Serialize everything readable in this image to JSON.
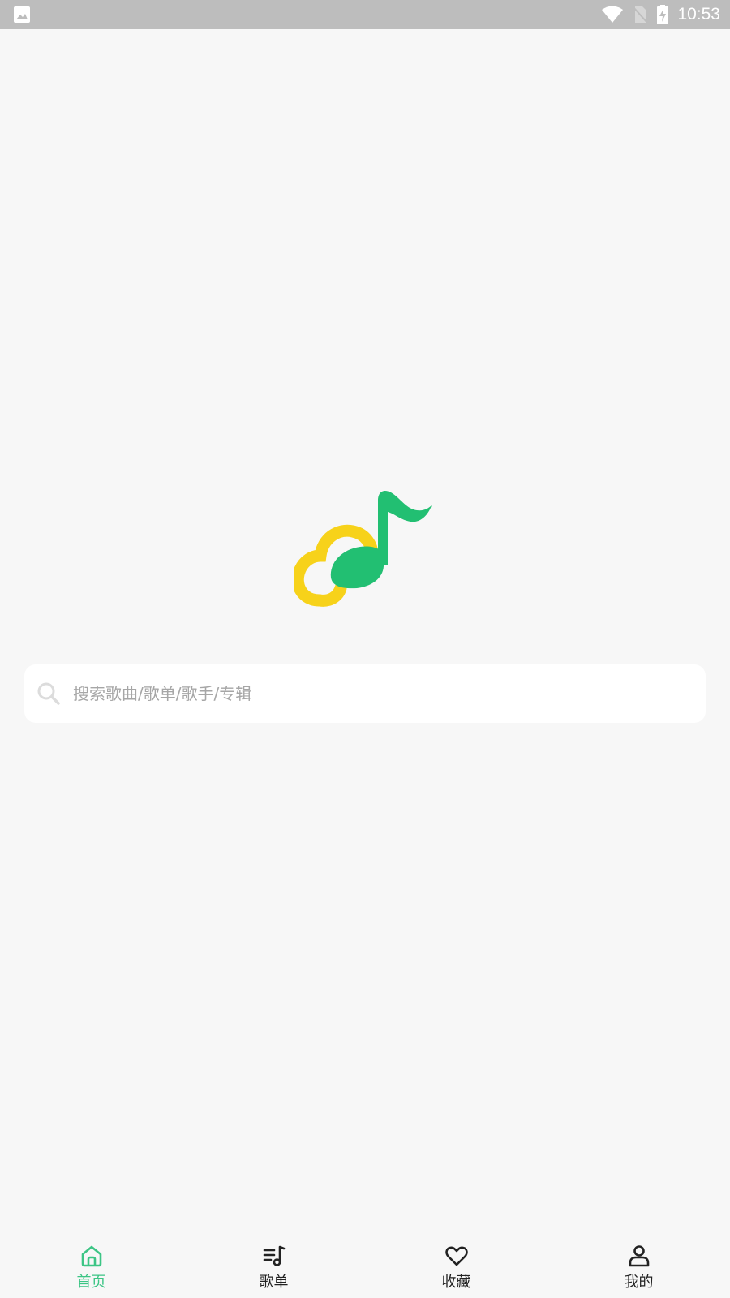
{
  "status_bar": {
    "time": "10:53",
    "icons": [
      "image-notification-icon",
      "wifi-icon",
      "no-sim-icon",
      "battery-charging-icon"
    ]
  },
  "logo": {
    "name": "music-app-logo",
    "colors": {
      "ring": "#f7d21a",
      "note": "#22bf72"
    }
  },
  "search": {
    "placeholder": "搜索歌曲/歌单/歌手/专辑",
    "value": "",
    "icon": "search-icon"
  },
  "tabs": [
    {
      "label": "首页",
      "icon": "home-icon",
      "active": true
    },
    {
      "label": "歌单",
      "icon": "playlist-icon",
      "active": false
    },
    {
      "label": "收藏",
      "icon": "heart-icon",
      "active": false
    },
    {
      "label": "我的",
      "icon": "user-icon",
      "active": false
    }
  ],
  "colors": {
    "accent": "#3cc585",
    "background": "#f7f7f7",
    "status_bar": "#bdbdbd"
  }
}
